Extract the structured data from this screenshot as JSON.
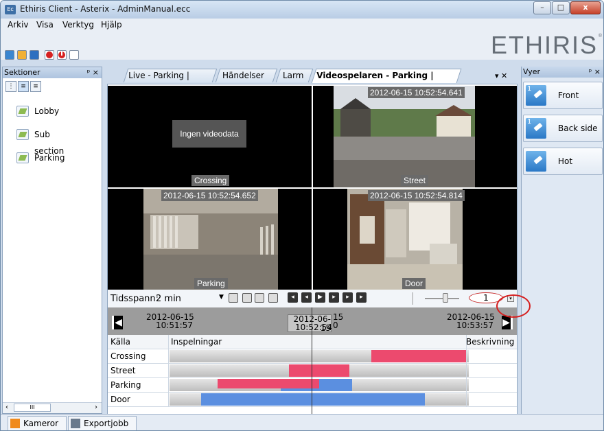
{
  "window": {
    "title": "Ethiris Client - Asterix - AdminManual.ecc",
    "app_icon_text": "Ec",
    "controls": {
      "minimize": "–",
      "maximize": "□",
      "close": "x"
    }
  },
  "menu": {
    "items": [
      "Arkiv",
      "Visa",
      "Verktyg",
      "Hjälp"
    ]
  },
  "brand": {
    "logo": "ETHIRIS",
    "registered": "®"
  },
  "sections_pane": {
    "title": "Sektioner",
    "controls": "ᵖ ×",
    "items": [
      {
        "label": "Lobby"
      },
      {
        "label": "Sub section"
      },
      {
        "label": "Parking"
      }
    ],
    "scroll_grip": "III"
  },
  "tabs": {
    "items": [
      {
        "label": "Live - Parking | Front",
        "active": false
      },
      {
        "label": "Händelser",
        "active": false
      },
      {
        "label": "Larm",
        "active": false
      },
      {
        "label": "Videospelaren - Parking | Front",
        "active": true
      }
    ],
    "controls": "▾ ✕"
  },
  "video_cells": [
    {
      "name": "Crossing",
      "timestamp": "",
      "no_video": "Ingen videodata"
    },
    {
      "name": "Street",
      "timestamp": "2012-06-15 10:52:54.641"
    },
    {
      "name": "Parking",
      "timestamp": "2012-06-15 10:52:54.652"
    },
    {
      "name": "Door",
      "timestamp": "2012-06-15 10:52:54.814"
    }
  ],
  "controls_bar": {
    "timespan_label": "Tidsspann:",
    "timespan_value": "2 min",
    "speed": "1"
  },
  "timeline": {
    "start_date": "2012-06-15",
    "start_time": "10:51:57",
    "cursor_date": "2012-06-15",
    "cursor_time": "10:52:54",
    "cursor_ghost_top": "15",
    "cursor_ghost_bottom": "0",
    "end_date": "2012-06-15",
    "end_time": "10:53:57"
  },
  "recordings": {
    "headers": {
      "source": "Källa",
      "recordings": "Inspelningar",
      "description": "Beskrivning"
    },
    "rows": [
      {
        "source": "Crossing",
        "description": ""
      },
      {
        "source": "Street",
        "description": ""
      },
      {
        "source": "Parking",
        "description": ""
      },
      {
        "source": "Door",
        "description": ""
      }
    ],
    "colors": {
      "motion": "#ec4a6e",
      "continuous": "#5b8fe0"
    }
  },
  "views_pane": {
    "title": "Vyer",
    "controls": "ᵖ ×",
    "items": [
      {
        "label": "Front",
        "badge": "1"
      },
      {
        "label": "Back side",
        "badge": "1"
      },
      {
        "label": "Hot",
        "badge": ""
      }
    ]
  },
  "bottom_tabs": [
    {
      "label": "Kameror"
    },
    {
      "label": "Exportjobb"
    }
  ]
}
